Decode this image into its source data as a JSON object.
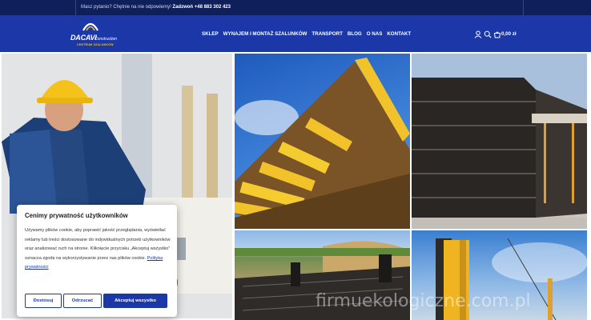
{
  "topbar": {
    "question": "Masz pytanio? Chętnie na nie odpowiemy!",
    "call_label": "Zadzwoń",
    "phone": "+48 883 302 423"
  },
  "logo": {
    "brand": "DACAVI",
    "brand_suffix": "Construction",
    "tagline": "CENTRUM SZALUNKÓW"
  },
  "nav": {
    "items": [
      "SKLEP",
      "WYNAJEM I MONTAŻ SZALUNKÓW",
      "TRANSPORT",
      "BLOG",
      "O NAS",
      "KONTAKT"
    ]
  },
  "header": {
    "icons": [
      "user-icon",
      "search-icon",
      "cart-icon"
    ],
    "cart_total": "0,00 zł"
  },
  "cookie": {
    "title": "Cenimy prywatność użytkowników",
    "body": "Używamy plików cookie, aby poprawić jakość przeglądania, wyświetlać reklamy lub treści dostosowane do indywidualnych potrzeb użytkowników oraz analizować ruch na stronie. Kliknięcie przycisku „Akceptuj wszystko” oznacza zgodę na wykorzystywanie przez nas plików cookie.",
    "link": "Polityka prywatności",
    "buttons": {
      "customize": "Dostosuj",
      "reject": "Odrzucać",
      "accept": "Akceptuj wszystko"
    }
  },
  "watermark": "firmuekologiczne.com.pl",
  "colors": {
    "topbar": "#0e1f5c",
    "header": "#1c37a8",
    "accent": "#f0c419"
  }
}
